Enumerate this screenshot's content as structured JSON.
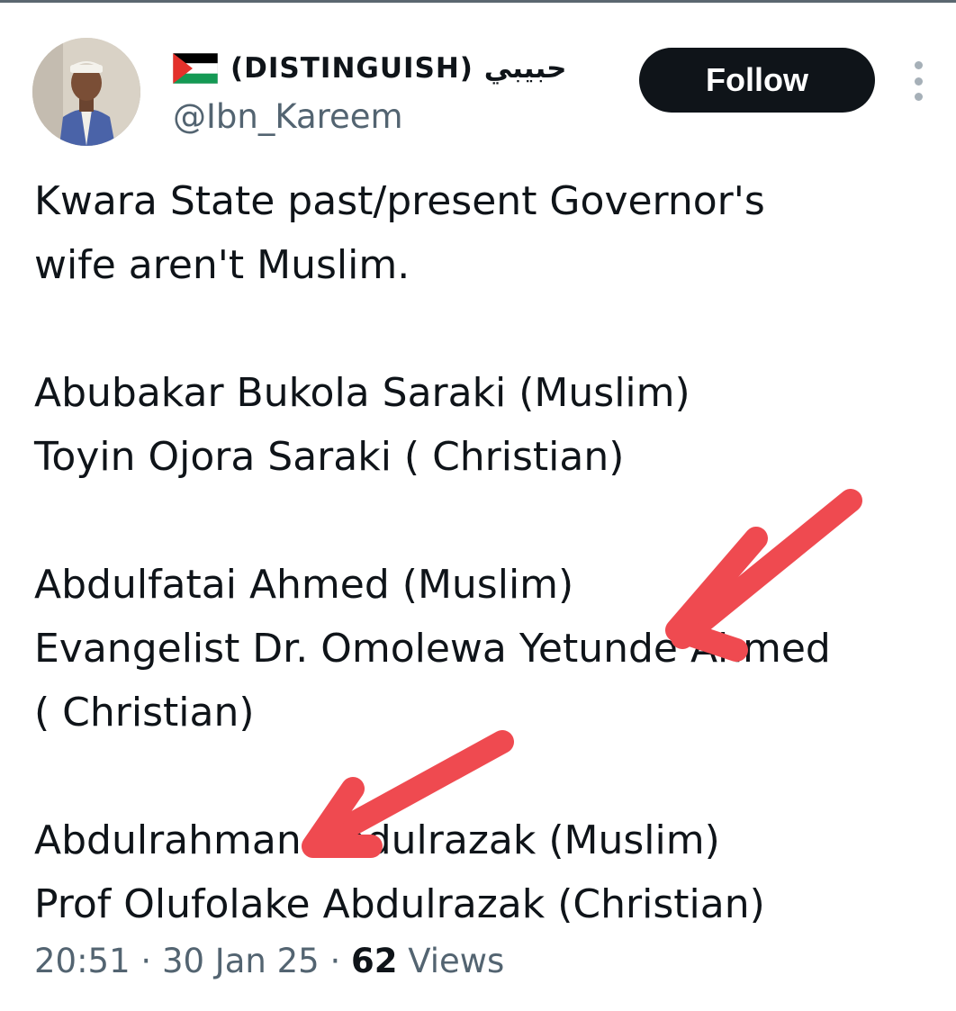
{
  "tweet": {
    "author": {
      "display_name": "(DISTINGUISH) حبيبي",
      "handle": "@Ibn_Kareem",
      "flag_icon": "palestine-flag-icon"
    },
    "follow_label": "Follow",
    "more_icon": "more-vertical-icon",
    "text_lines": [
      "Kwara State past/present Governor's",
      "wife aren't Muslim.",
      "",
      "Abubakar Bukola Saraki (Muslim)",
      "Toyin Ojora Saraki ( Christian)",
      "",
      "Abdulfatai Ahmed (Muslim)",
      "Evangelist Dr. Omolewa Yetunde Ahmed",
      "( Christian)",
      "",
      "Abdulrahman Abdulrazak (Muslim)",
      "Prof Olufolake Abdulrazak (Christian)"
    ],
    "meta": {
      "time": "20:51",
      "separator": "·",
      "date": "30 Jan 25",
      "views_count": "62",
      "views_label": "Views"
    },
    "colors": {
      "text": "#0f1419",
      "secondary": "#536471",
      "button_bg": "#0f1419",
      "arrow": "#ef4a50"
    }
  }
}
